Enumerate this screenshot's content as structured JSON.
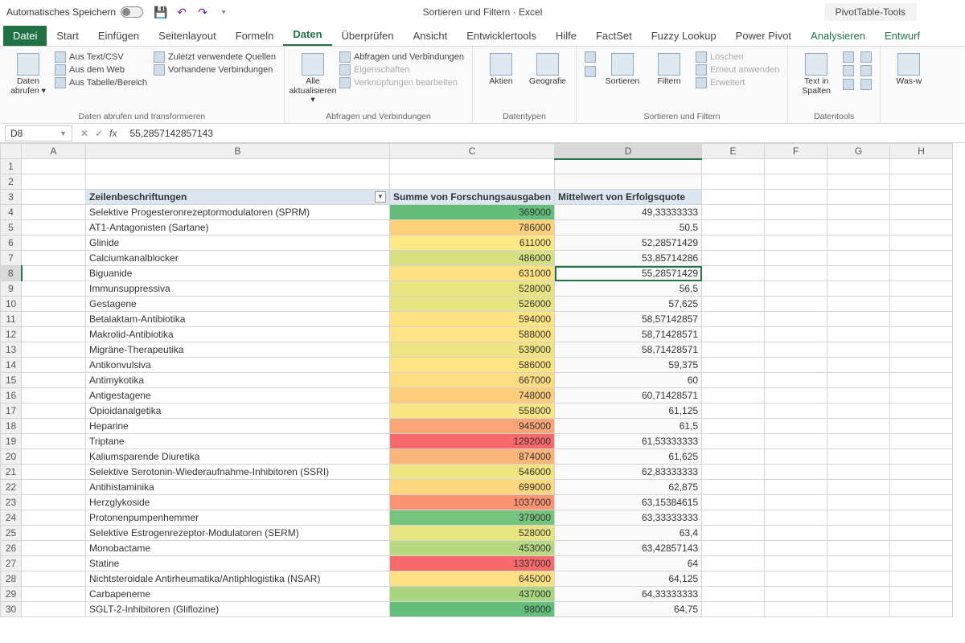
{
  "title_bar": {
    "autosave": "Automatisches Speichern",
    "doc_title": "Sortieren und Filtern · Excel",
    "tool_context": "PivotTable-Tools"
  },
  "tabs": {
    "file": "Datei",
    "start": "Start",
    "einfuegen": "Einfügen",
    "seitenlayout": "Seitenlayout",
    "formeln": "Formeln",
    "daten": "Daten",
    "ueberpruefen": "Überprüfen",
    "ansicht": "Ansicht",
    "entwickler": "Entwicklertools",
    "hilfe": "Hilfe",
    "factset": "FactSet",
    "fuzzy": "Fuzzy Lookup",
    "powerpivot": "Power Pivot",
    "analysieren": "Analysieren",
    "entwurf": "Entwurf"
  },
  "ribbon": {
    "g1": {
      "big": "Daten abrufen ▾",
      "items": [
        "Aus Text/CSV",
        "Aus dem Web",
        "Aus Tabelle/Bereich",
        "Zuletzt verwendete Quellen",
        "Vorhandene Verbindungen"
      ],
      "label": "Daten abrufen und transformieren"
    },
    "g2": {
      "big": "Alle aktualisieren ▾",
      "items": [
        "Abfragen und Verbindungen",
        "Eigenschaften",
        "Verknüpfungen bearbeiten"
      ],
      "label": "Abfragen und Verbindungen"
    },
    "g3": {
      "aktien": "Aktien",
      "geo": "Geografie",
      "label": "Datentypen"
    },
    "g4": {
      "sort": "Sortieren",
      "filter": "Filtern",
      "loeschen": "Löschen",
      "erneut": "Erneut anwenden",
      "erweitert": "Erweitert",
      "label": "Sortieren und Filtern"
    },
    "g5": {
      "text": "Text in Spalten",
      "label": "Datentools"
    },
    "g6": {
      "was": "Was-w"
    }
  },
  "formula_bar": {
    "cell_ref": "D8",
    "formula": "55,2857142857143"
  },
  "pivot_headers": {
    "row_labels": "Zeilenbeschriftungen",
    "sum_col": "Summe von Forschungsausgaben",
    "avg_col": "Mittelwert von Erfolgsquote"
  },
  "columns": [
    "A",
    "B",
    "C",
    "D",
    "E",
    "F",
    "G",
    "H"
  ],
  "rows": [
    {
      "n": 4,
      "label": "Selektive Progesteronrezeptormodulatoren (SPRM)",
      "sum": "369000",
      "avg": "49,33333333",
      "c": "#63be7b"
    },
    {
      "n": 5,
      "label": "AT1-Antagonisten (Sartane)",
      "sum": "786000",
      "avg": "50,5",
      "c": "#fcd17a"
    },
    {
      "n": 6,
      "label": "Glinide",
      "sum": "611000",
      "avg": "52,28571429",
      "c": "#fee883"
    },
    {
      "n": 7,
      "label": "Calciumkanalblocker",
      "sum": "486000",
      "avg": "53,85714286",
      "c": "#d7e182"
    },
    {
      "n": 8,
      "label": "Biguanide",
      "sum": "631000",
      "avg": "55,28571429",
      "c": "#fee182"
    },
    {
      "n": 9,
      "label": "Immunsuppressiva",
      "sum": "528000",
      "avg": "56,5",
      "c": "#e9e482"
    },
    {
      "n": 10,
      "label": "Gestagene",
      "sum": "526000",
      "avg": "57,625",
      "c": "#e9e482"
    },
    {
      "n": 11,
      "label": "Betalaktam-Antibiotika",
      "sum": "594000",
      "avg": "58,57142857",
      "c": "#fee383"
    },
    {
      "n": 12,
      "label": "Makrolid-Antibiotika",
      "sum": "588000",
      "avg": "58,71428571",
      "c": "#fee483"
    },
    {
      "n": 13,
      "label": "Migräne-Therapeutika",
      "sum": "539000",
      "avg": "58,71428571",
      "c": "#eee582"
    },
    {
      "n": 14,
      "label": "Antikonvulsiva",
      "sum": "586000",
      "avg": "59,375",
      "c": "#fee483"
    },
    {
      "n": 15,
      "label": "Antimykotika",
      "sum": "667000",
      "avg": "60",
      "c": "#fedd81"
    },
    {
      "n": 16,
      "label": "Antigestagene",
      "sum": "748000",
      "avg": "60,71428571",
      "c": "#fdcd7d"
    },
    {
      "n": 17,
      "label": "Opioidanalgetika",
      "sum": "558000",
      "avg": "61,125",
      "c": "#f7e683"
    },
    {
      "n": 18,
      "label": "Heparine",
      "sum": "945000",
      "avg": "61,5",
      "c": "#fba676"
    },
    {
      "n": 19,
      "label": "Triptane",
      "sum": "1292000",
      "avg": "61,53333333",
      "c": "#f8696b"
    },
    {
      "n": 20,
      "label": "Kaliumsparende Diuretika",
      "sum": "874000",
      "avg": "61,625",
      "c": "#fcb579"
    },
    {
      "n": 21,
      "label": "Selektive Serotonin-Wiederaufnahme-Inhibitoren (SSRI)",
      "sum": "546000",
      "avg": "62,83333333",
      "c": "#f1e582"
    },
    {
      "n": 22,
      "label": "Antihistaminika",
      "sum": "699000",
      "avg": "62,875",
      "c": "#fdd780"
    },
    {
      "n": 23,
      "label": "Herzglykoside",
      "sum": "1037000",
      "avg": "63,15384615",
      "c": "#fa9473"
    },
    {
      "n": 24,
      "label": "Protonenpumpenhemmer",
      "sum": "379000",
      "avg": "63,33333333",
      "c": "#76c37d"
    },
    {
      "n": 25,
      "label": "Selektive Estrogenrezeptor-Modulatoren (SERM)",
      "sum": "528000",
      "avg": "63,4",
      "c": "#e9e482"
    },
    {
      "n": 26,
      "label": "Monobactame",
      "sum": "453000",
      "avg": "63,42857143",
      "c": "#b9d980"
    },
    {
      "n": 27,
      "label": "Statine",
      "sum": "1337000",
      "avg": "64",
      "c": "#f8696b"
    },
    {
      "n": 28,
      "label": "Nichtsteroidale Antirheumatika/Antiphlogistika (NSAR)",
      "sum": "645000",
      "avg": "64,125",
      "c": "#fee082"
    },
    {
      "n": 29,
      "label": "Carbapeneme",
      "sum": "437000",
      "avg": "64,33333333",
      "c": "#a9d57f"
    },
    {
      "n": 30,
      "label": "SGLT-2-Inhibitoren (Gliflozine)",
      "sum": "98000",
      "avg": "64,75",
      "c": "#63be7b"
    }
  ],
  "chart_data": {
    "type": "table",
    "title": "PivotTable: Forschungsausgaben & Erfolgsquote nach Wirkstoffklasse",
    "columns": [
      "Zeilenbeschriftungen",
      "Summe von Forschungsausgaben",
      "Mittelwert von Erfolgsquote"
    ],
    "series": [
      {
        "name": "Summe von Forschungsausgaben",
        "values": [
          369000,
          786000,
          611000,
          486000,
          631000,
          528000,
          526000,
          594000,
          588000,
          539000,
          586000,
          667000,
          748000,
          558000,
          945000,
          1292000,
          874000,
          546000,
          699000,
          1037000,
          379000,
          528000,
          453000,
          1337000,
          645000,
          437000,
          98000
        ]
      },
      {
        "name": "Mittelwert von Erfolgsquote",
        "values": [
          49.333,
          50.5,
          52.286,
          53.857,
          55.286,
          56.5,
          57.625,
          58.571,
          58.714,
          58.714,
          59.375,
          60,
          60.714,
          61.125,
          61.5,
          61.533,
          61.625,
          62.833,
          62.875,
          63.154,
          63.333,
          63.4,
          63.429,
          64,
          64.125,
          64.333,
          64.75
        ]
      }
    ],
    "categories": [
      "Selektive Progesteronrezeptormodulatoren (SPRM)",
      "AT1-Antagonisten (Sartane)",
      "Glinide",
      "Calciumkanalblocker",
      "Biguanide",
      "Immunsuppressiva",
      "Gestagene",
      "Betalaktam-Antibiotika",
      "Makrolid-Antibiotika",
      "Migräne-Therapeutika",
      "Antikonvulsiva",
      "Antimykotika",
      "Antigestagene",
      "Opioidanalgetika",
      "Heparine",
      "Triptane",
      "Kaliumsparende Diuretika",
      "Selektive Serotonin-Wiederaufnahme-Inhibitoren (SSRI)",
      "Antihistaminika",
      "Herzglykoside",
      "Protonenpumpenhemmer",
      "Selektive Estrogenrezeptor-Modulatoren (SERM)",
      "Monobactame",
      "Statine",
      "Nichtsteroidale Antirheumatika/Antiphlogistika (NSAR)",
      "Carbapeneme",
      "SGLT-2-Inhibitoren (Gliflozine)"
    ]
  }
}
